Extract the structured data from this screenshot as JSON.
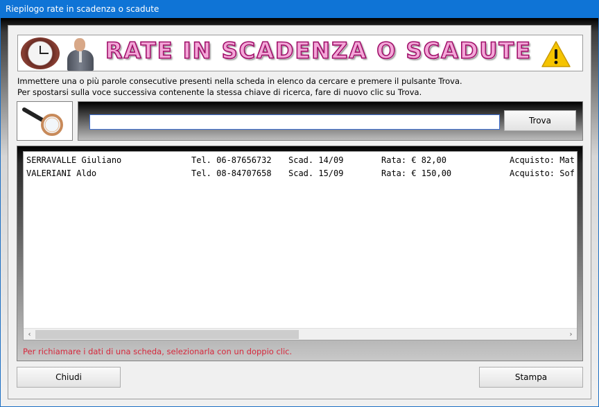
{
  "window": {
    "title": "Riepilogo rate in scadenza o scadute"
  },
  "banner": {
    "title": "RATE IN SCADENZA O SCADUTE",
    "icons": [
      "clock-icon",
      "businessman-icon",
      "warning-icon"
    ]
  },
  "instructions": {
    "line1": "Immettere una o più parole consecutive presenti nella scheda in elenco da cercare e premere il pulsante Trova.",
    "line2": "Per spostarsi sulla voce successiva contenente la stessa chiave di ricerca, fare di nuovo clic su Trova."
  },
  "search": {
    "icon": "magnifier-icon",
    "value": "",
    "button_label": "Trova"
  },
  "list": {
    "rows": [
      {
        "name": "SERRAVALLE Giuliano",
        "tel": "Tel. 06-87656732",
        "scad": "Scad. 14/09",
        "rata": "Rata: € 82,00",
        "acquisto": "Acquisto: Mat"
      },
      {
        "name": "VALERIANI Aldo",
        "tel": "Tel. 08-84707658",
        "scad": "Scad. 15/09",
        "rata": "Rata: € 150,00",
        "acquisto": "Acquisto: Sof"
      }
    ],
    "scroll_left_glyph": "‹",
    "scroll_right_glyph": "›"
  },
  "hint": "Per richiamare i dati di una scheda, selezionarla con un doppio clic.",
  "footer": {
    "close_label": "Chiudi",
    "print_label": "Stampa"
  },
  "colors": {
    "titlebar": "#0f74d6",
    "hint": "#d6283c",
    "banner_text": "#f4a6d8",
    "banner_outline": "#a0106a"
  }
}
